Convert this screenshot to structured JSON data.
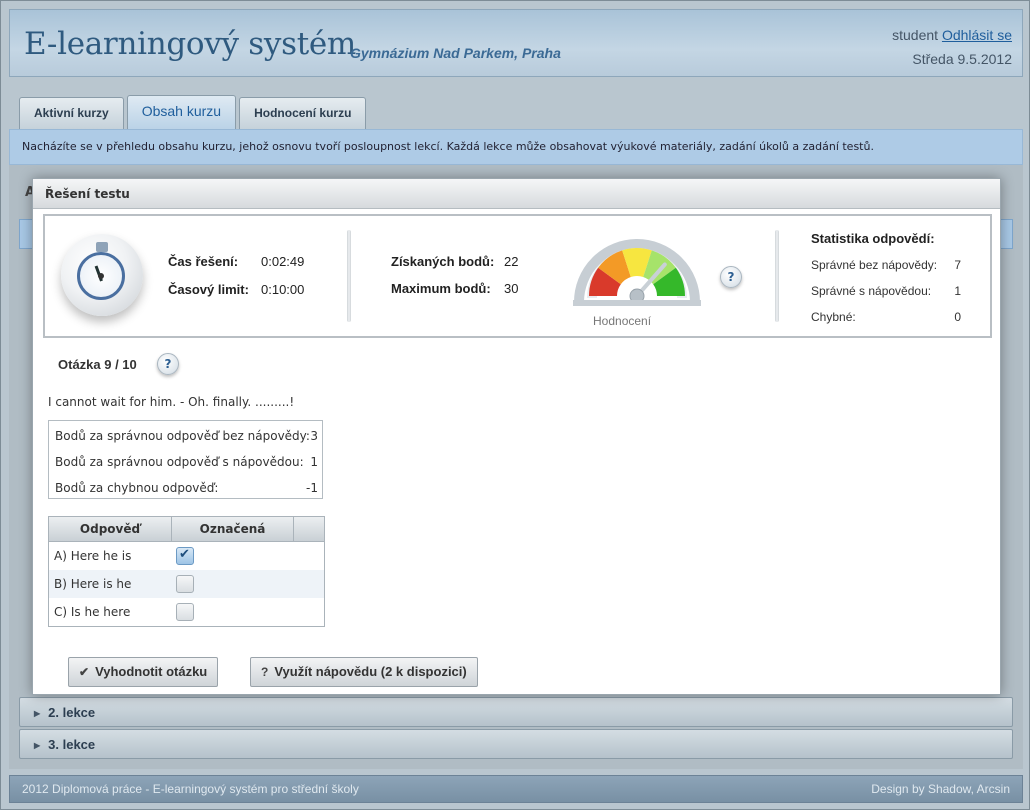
{
  "header": {
    "app_title": "E-learningový systém",
    "school": "Gymnázium Nad Parkem, Praha",
    "user": "student",
    "logout": "Odhlásit se",
    "date": "Středa 9.5.2012"
  },
  "tabs": [
    {
      "label": "Aktivní kurzy",
      "active": false
    },
    {
      "label": "Obsah kurzu",
      "active": true
    },
    {
      "label": "Hodnocení kurzu",
      "active": false
    }
  ],
  "info_text": "Nacházíte se v přehledu obsahu kurzu, jehož osnovu tvoří posloupnost lekcí. Každá lekce může obsahovat výukové materiály, zadání úkolů a zadání testů.",
  "background": {
    "letter": "A",
    "sections": [
      "2. lekce",
      "3. lekce"
    ]
  },
  "modal": {
    "title": "Řešení testu",
    "time_label": "Čas řešení:",
    "time_value": "0:02:49",
    "limit_label": "Časový limit:",
    "limit_value": "0:10:00",
    "points_label": "Získaných bodů:",
    "points_value": "22",
    "max_label": "Maximum bodů:",
    "max_value": "30",
    "gauge_label": "Hodnocení",
    "gauge_level": 0.73,
    "help": "?",
    "stats": {
      "title": "Statistika odpovědí:",
      "rows": [
        {
          "label": "Správné bez nápovědy:",
          "value": "7"
        },
        {
          "label": "Správné s nápovědou:",
          "value": "1"
        },
        {
          "label": "Chybné:",
          "value": "0"
        }
      ]
    },
    "question": {
      "number": "Otázka 9 / 10",
      "text": "I cannot wait for him. - Oh. finally. .........!",
      "points": [
        {
          "label": "Bodů za správnou odpověď bez nápovědy:",
          "value": "3"
        },
        {
          "label": "Bodů za správnou odpověď s nápovědou:",
          "value": "1"
        },
        {
          "label": "Bodů za chybnou odpověď:",
          "value": "-1"
        }
      ],
      "answers_header": {
        "answer": "Odpověď",
        "marked": "Označená"
      },
      "answers": [
        {
          "label": "A) Here he is",
          "checked": true
        },
        {
          "label": "B) Here is he",
          "checked": false
        },
        {
          "label": "C) Is he here",
          "checked": false
        }
      ]
    },
    "buttons": {
      "evaluate": "Vyhodnotit otázku",
      "hint": "Využít nápovědu (2 k dispozici)"
    }
  },
  "footer": {
    "left": "2012 Diplomová práce - E-learningový systém pro střední školy",
    "right": "Design by Shadow, Arcsin"
  },
  "colors": {
    "gauge_red": "#d93a2b",
    "gauge_orange": "#f39a26",
    "gauge_yellow": "#f7e640",
    "gauge_lightgreen": "#a6e36a",
    "gauge_green": "#35b82a"
  }
}
